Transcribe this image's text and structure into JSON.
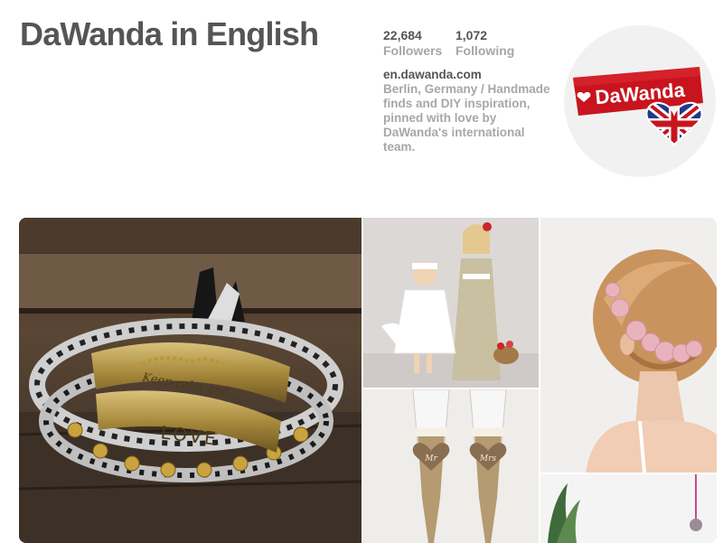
{
  "board": {
    "title": "DaWanda in English"
  },
  "stats": {
    "followers_count": "22,684",
    "followers_label": "Followers",
    "following_count": "1,072",
    "following_label": "Following"
  },
  "bio": {
    "url": "en.dawanda.com",
    "description": "Berlin, Germany / Handmade finds and DIY inspiration, pinned with love by DaWanda's international team."
  },
  "logo": {
    "text": "DaWanda"
  },
  "pins": {
    "bracelet_engraving_1": "Keep calm and...",
    "bracelet_engraving_2": "LOVE",
    "glass_tag_1": "Mr",
    "glass_tag_2": "Mrs"
  },
  "colors": {
    "logo_red": "#c8141e",
    "text_dark": "#555555",
    "text_muted": "#a7a7a7"
  }
}
